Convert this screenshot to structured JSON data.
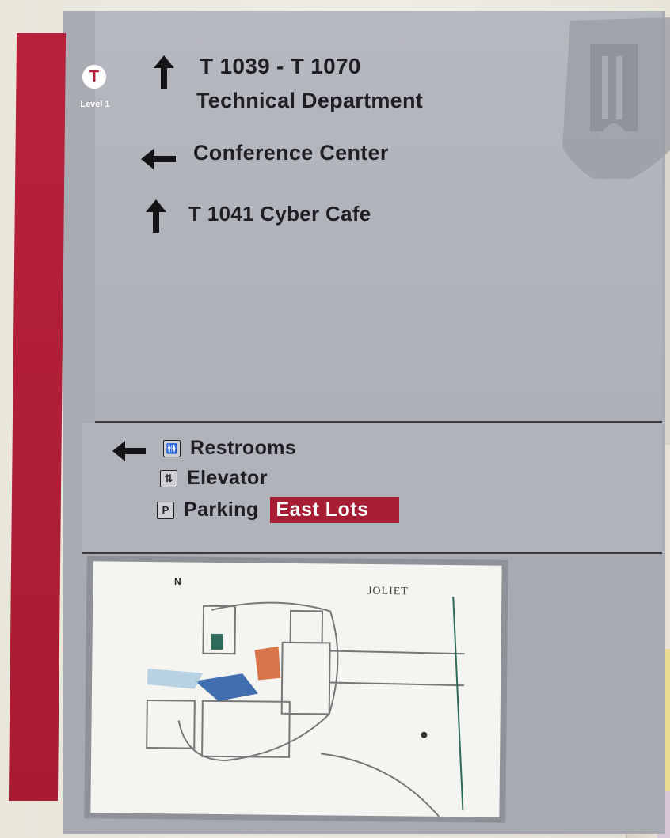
{
  "sign": {
    "badge": "T",
    "level": "Level 1",
    "directions": [
      {
        "arrow": "up",
        "lines": [
          "T 1039 - T 1070",
          "Technical Department"
        ]
      },
      {
        "arrow": "left",
        "lines": [
          "Conference Center"
        ]
      },
      {
        "arrow": "up",
        "lines": [
          "T 1041 Cyber Cafe"
        ]
      }
    ],
    "amenities": {
      "arrow": "left",
      "items": [
        {
          "icon": "restroom-icon",
          "glyph": "🚻",
          "label": "Restrooms"
        },
        {
          "icon": "elevator-icon",
          "glyph": "⇅",
          "label": "Elevator"
        },
        {
          "icon": "parking-icon",
          "glyph": "P",
          "label": "Parking"
        }
      ],
      "parking_tag": "East Lots"
    },
    "map": {
      "title": "JOLIET",
      "north": "N"
    },
    "colors": {
      "brand_red": "#a91b33",
      "panel_gray": "#b1b3ba",
      "text_dark": "#202024"
    }
  }
}
